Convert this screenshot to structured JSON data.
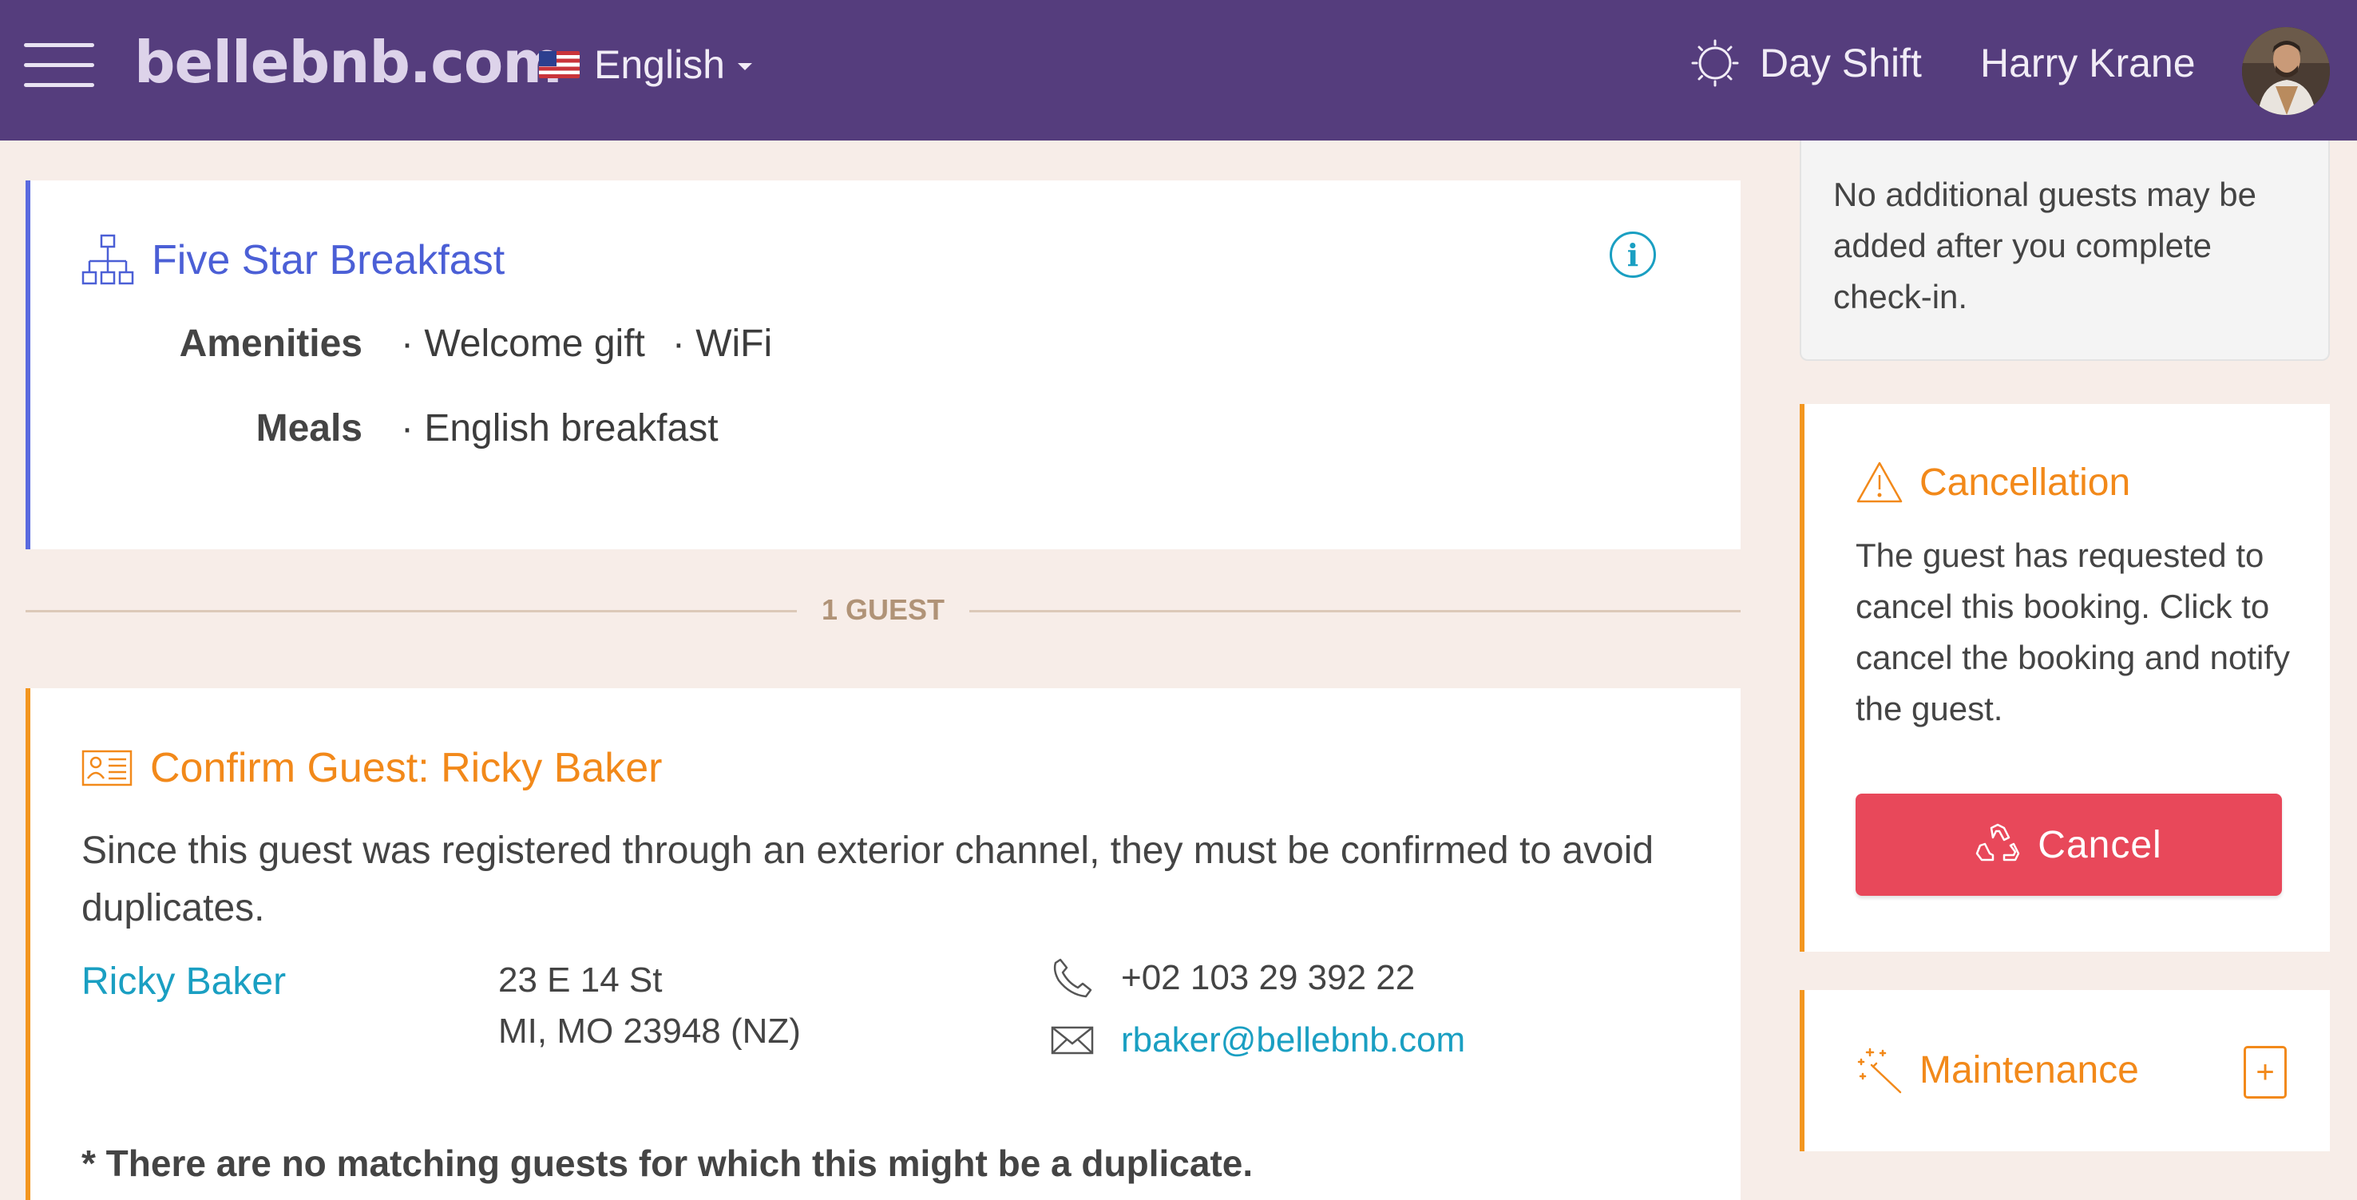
{
  "header": {
    "brand": "bellebnb.com",
    "language": "English",
    "shift_label": "Day Shift",
    "user_name": "Harry Krane"
  },
  "breakfast_card": {
    "title": "Five Star Breakfast",
    "rows": [
      {
        "label": "Amenities",
        "items": [
          "Welcome gift",
          "WiFi"
        ]
      },
      {
        "label": "Meals",
        "items": [
          "English breakfast"
        ]
      }
    ]
  },
  "guest_divider": "1 GUEST",
  "guest_card": {
    "title": "Confirm Guest: Ricky Baker",
    "description": "Since this guest was registered through an exterior channel, they must be confirmed to avoid duplicates.",
    "guest_name": "Ricky Baker",
    "address_line1": "23 E 14 St",
    "address_line2": "MI, MO 23948 (NZ)",
    "phone": "+02 103 29 392 22",
    "email": "rbaker@bellebnb.com",
    "duplicate_note": "* There are no matching guests for which this might be a duplicate."
  },
  "sidebar": {
    "note": "No additional guests may be added after you complete check-in.",
    "cancellation": {
      "title": "Cancellation",
      "text": "The guest has requested to cancel this booking. Click to cancel the booking and notify the guest.",
      "button_label": "Cancel"
    },
    "maintenance": {
      "title": "Maintenance",
      "add_label": "+"
    }
  },
  "colors": {
    "header_bg": "#553d7d",
    "page_bg": "#f7ede8",
    "accent_blue": "#4b5fd6",
    "accent_orange": "#f2891a",
    "link": "#1a9fc2",
    "danger": "#e8485a"
  }
}
